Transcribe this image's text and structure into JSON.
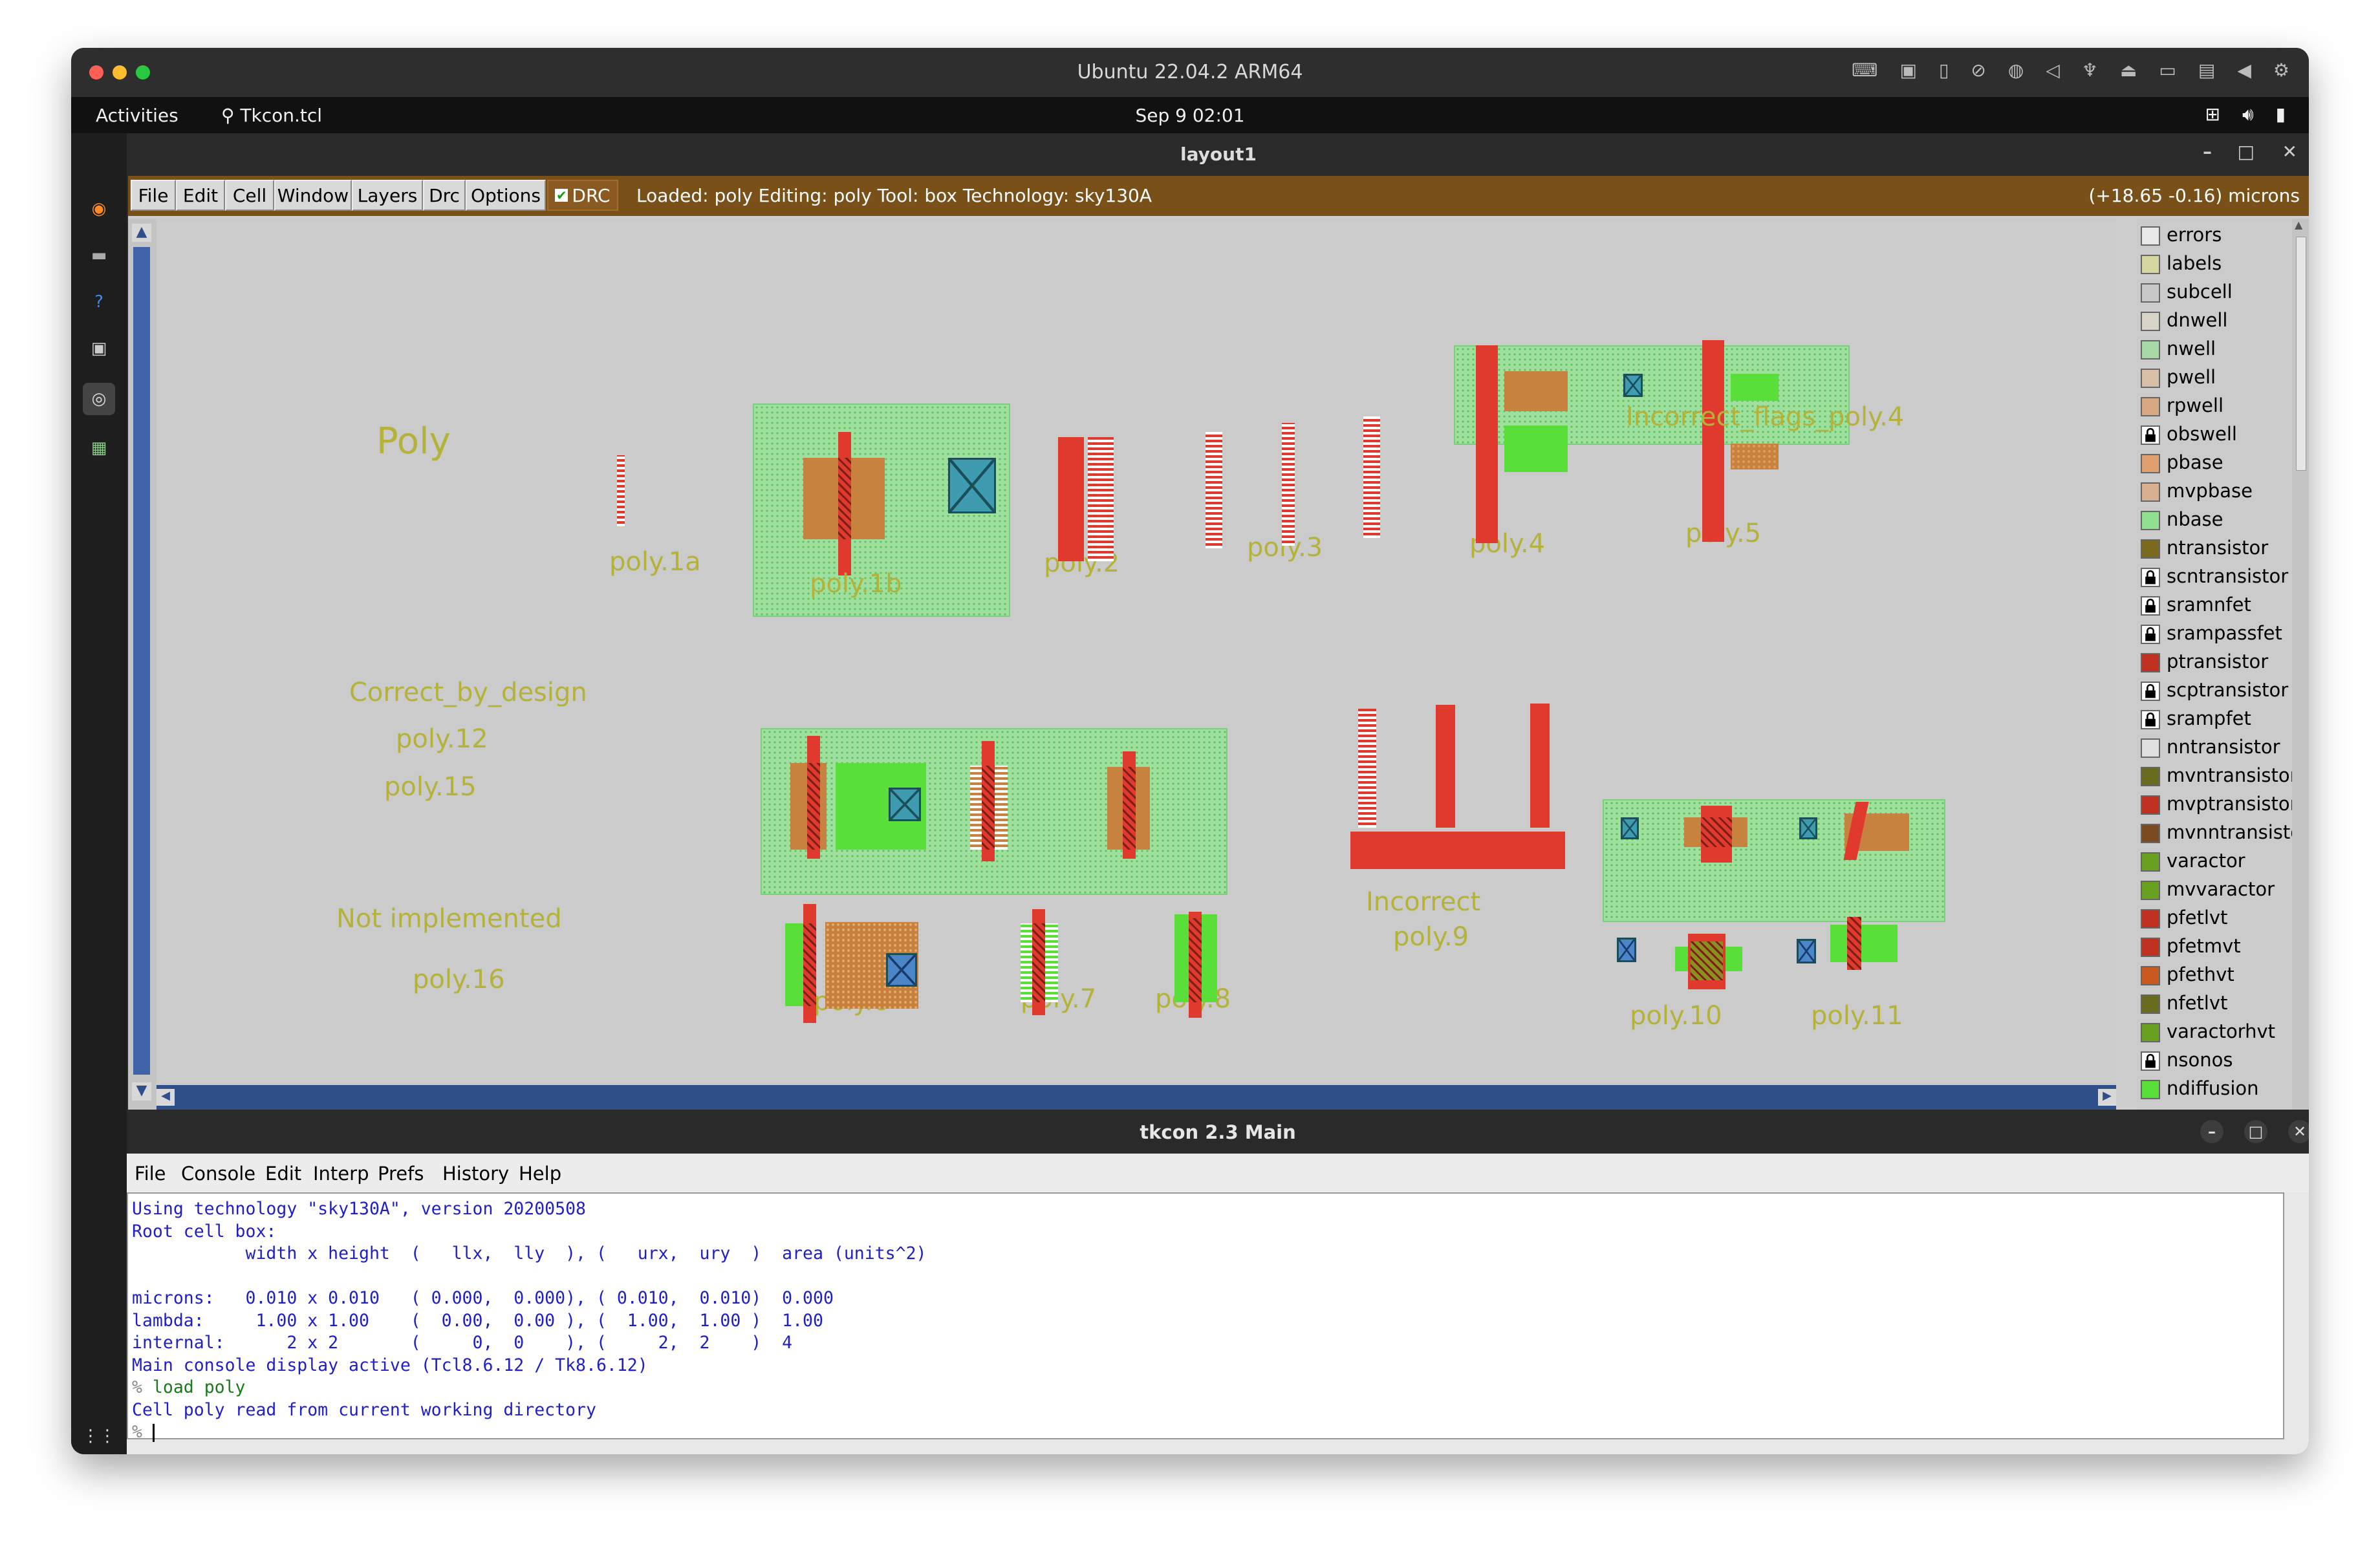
{
  "vm": {
    "title": "Ubuntu 22.04.2 ARM64"
  },
  "topbar": {
    "activities": "Activities",
    "app_name": "Tkcon.tcl",
    "clock": "Sep 9  02:01"
  },
  "magic": {
    "window_title": "layout1",
    "menu": [
      "File",
      "Edit",
      "Cell",
      "Window",
      "Layers",
      "Drc",
      "Options"
    ],
    "drc_label": "DRC",
    "drc_checked": true,
    "status": "Loaded: poly Editing: poly Tool: box  Technology: sky130A",
    "coords": "(+18.65 -0.16) microns",
    "canvas_labels": {
      "poly": "Poly",
      "poly_1a": "poly.1a",
      "poly_1b": "poly.1b",
      "poly_2": "poly.2",
      "poly_3": "poly.3",
      "poly_4": "poly.4",
      "poly_5": "poly.5",
      "incorrect_flags": "Incorrect_flags_poly.4",
      "correct_by_design": "Correct_by_design",
      "poly_12": "poly.12",
      "poly_15": "poly.15",
      "not_implemented": "Not implemented",
      "poly_16": "poly.16",
      "poly_6": "poly.6",
      "poly_7": "poly.7",
      "poly_8": "poly.8",
      "incorrect": "Incorrect",
      "poly_9": "poly.9",
      "poly_10": "poly.10",
      "poly_11": "poly.11"
    },
    "layers": [
      {
        "name": "errors",
        "color": "#e8e8e8",
        "locked": false
      },
      {
        "name": "labels",
        "color": "#d6d6a0",
        "locked": false
      },
      {
        "name": "subcell",
        "color": "#c8c8c8",
        "locked": false
      },
      {
        "name": "dnwell",
        "color": "#d8d4c8",
        "locked": false
      },
      {
        "name": "nwell",
        "color": "#a8d8a8",
        "locked": false
      },
      {
        "name": "pwell",
        "color": "#d8c0a8",
        "locked": false
      },
      {
        "name": "rpwell",
        "color": "#d8a880",
        "locked": false
      },
      {
        "name": "obswell",
        "color": "#bbbbbb",
        "locked": true
      },
      {
        "name": "pbase",
        "color": "#e0a070",
        "locked": false
      },
      {
        "name": "mvpbase",
        "color": "#d8b090",
        "locked": false
      },
      {
        "name": "nbase",
        "color": "#90e090",
        "locked": false
      },
      {
        "name": "ntransistor",
        "color": "#7a6a20",
        "locked": false
      },
      {
        "name": "scntransistor",
        "color": "#bbbbbb",
        "locked": true
      },
      {
        "name": "sramnfet",
        "color": "#bbbbbb",
        "locked": true
      },
      {
        "name": "srampassfet",
        "color": "#bbbbbb",
        "locked": true
      },
      {
        "name": "ptransistor",
        "color": "#c03020",
        "locked": false
      },
      {
        "name": "scptransistor",
        "color": "#bbbbbb",
        "locked": true
      },
      {
        "name": "srampfet",
        "color": "#bbbbbb",
        "locked": true
      },
      {
        "name": "nntransistor",
        "color": "#e0e0e0",
        "locked": false
      },
      {
        "name": "mvntransistor",
        "color": "#6a6a20",
        "locked": false
      },
      {
        "name": "mvptransistor",
        "color": "#c03020",
        "locked": false
      },
      {
        "name": "mvnntransistor",
        "color": "#7a4a20",
        "locked": false
      },
      {
        "name": "varactor",
        "color": "#6aa020",
        "locked": false
      },
      {
        "name": "mvvaractor",
        "color": "#6aa020",
        "locked": false
      },
      {
        "name": "pfetlvt",
        "color": "#c03020",
        "locked": false
      },
      {
        "name": "pfetmvt",
        "color": "#c03020",
        "locked": false
      },
      {
        "name": "pfethvt",
        "color": "#c85a20",
        "locked": false
      },
      {
        "name": "nfetlvt",
        "color": "#6a6a20",
        "locked": false
      },
      {
        "name": "varactorhvt",
        "color": "#6aa020",
        "locked": false
      },
      {
        "name": "nsonos",
        "color": "#bbbbbb",
        "locked": true
      },
      {
        "name": "ndiffusion",
        "color": "#5adf3a",
        "locked": false
      }
    ]
  },
  "tkcon": {
    "window_title": "tkcon 2.3 Main",
    "menu": [
      "File",
      "Console",
      "Edit",
      "Interp",
      "Prefs",
      "History",
      "Help"
    ],
    "lines": [
      "Using technology \"sky130A\", version 20200508",
      "Root cell box:",
      "           width x height  (   llx,  lly  ), (   urx,  ury  )  area (units^2)",
      "",
      "microns:   0.010 x 0.010   ( 0.000,  0.000), ( 0.010,  0.010)  0.000",
      "lambda:     1.00 x 1.00    (  0.00,  0.00 ), (  1.00,  1.00 )  1.00",
      "internal:      2 x 2       (     0,  0    ), (     2,  2    )  4",
      "Main console display active (Tcl8.6.12 / Tk8.6.12)"
    ],
    "prompt": "% ",
    "command": "load poly",
    "result": "Cell poly read from current working directory",
    "prompt2": "% "
  }
}
